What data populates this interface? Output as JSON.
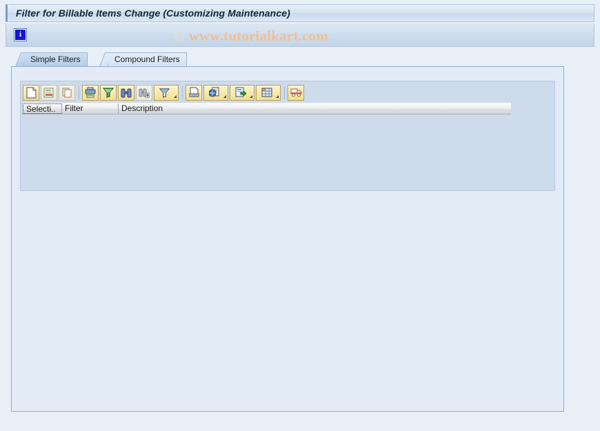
{
  "window": {
    "title": "Filter for Billable Items Change (Customizing Maintenance)"
  },
  "app_toolbar": {
    "info_icon_label": "i",
    "watermark_copyright": "©",
    "watermark_text": "www.tutorialkart.com"
  },
  "tabs": [
    {
      "label": "Simple Filters",
      "active": true
    },
    {
      "label": "Compound Filters",
      "active": false
    }
  ],
  "grid_toolbar": {
    "buttons": [
      {
        "name": "new-entries-button",
        "icon": "new-document-icon",
        "enabled": true,
        "dropdown": false
      },
      {
        "name": "change-entry-button",
        "icon": "change-document-icon",
        "enabled": false,
        "dropdown": false
      },
      {
        "name": "copy-entry-button",
        "icon": "copy-icon",
        "enabled": false,
        "dropdown": false
      },
      {
        "name": "print-button",
        "icon": "printer-icon",
        "enabled": true,
        "dropdown": false
      },
      {
        "name": "filter-button",
        "icon": "funnel-icon",
        "enabled": true,
        "dropdown": false
      },
      {
        "name": "find-button",
        "icon": "binoculars-icon",
        "enabled": true,
        "dropdown": false
      },
      {
        "name": "find-next-button",
        "icon": "binoculars-plus-icon",
        "enabled": false,
        "dropdown": false
      },
      {
        "name": "set-filter-button",
        "icon": "funnel-filter-icon",
        "enabled": true,
        "dropdown": true
      },
      {
        "name": "print-preview-button",
        "icon": "print-preview-icon",
        "enabled": true,
        "dropdown": false
      },
      {
        "name": "view-selection-button",
        "icon": "globe-document-icon",
        "enabled": true,
        "dropdown": true
      },
      {
        "name": "export-button",
        "icon": "export-arrow-icon",
        "enabled": true,
        "dropdown": true
      },
      {
        "name": "layout-button",
        "icon": "grid-layout-icon",
        "enabled": true,
        "dropdown": true
      },
      {
        "name": "transport-button",
        "icon": "truck-icon",
        "enabled": true,
        "dropdown": false
      }
    ]
  },
  "grid": {
    "columns": [
      {
        "key": "selection",
        "label": "Selecti.."
      },
      {
        "key": "filter",
        "label": "Filter"
      },
      {
        "key": "description",
        "label": "Description"
      }
    ],
    "rows": []
  },
  "colors": {
    "title_text": "#14283c",
    "watermark": "#f0bf92",
    "panel_border": "#91aecb",
    "grid_background": "#cddbeb",
    "toolbar_button": "#f8e9a8"
  }
}
